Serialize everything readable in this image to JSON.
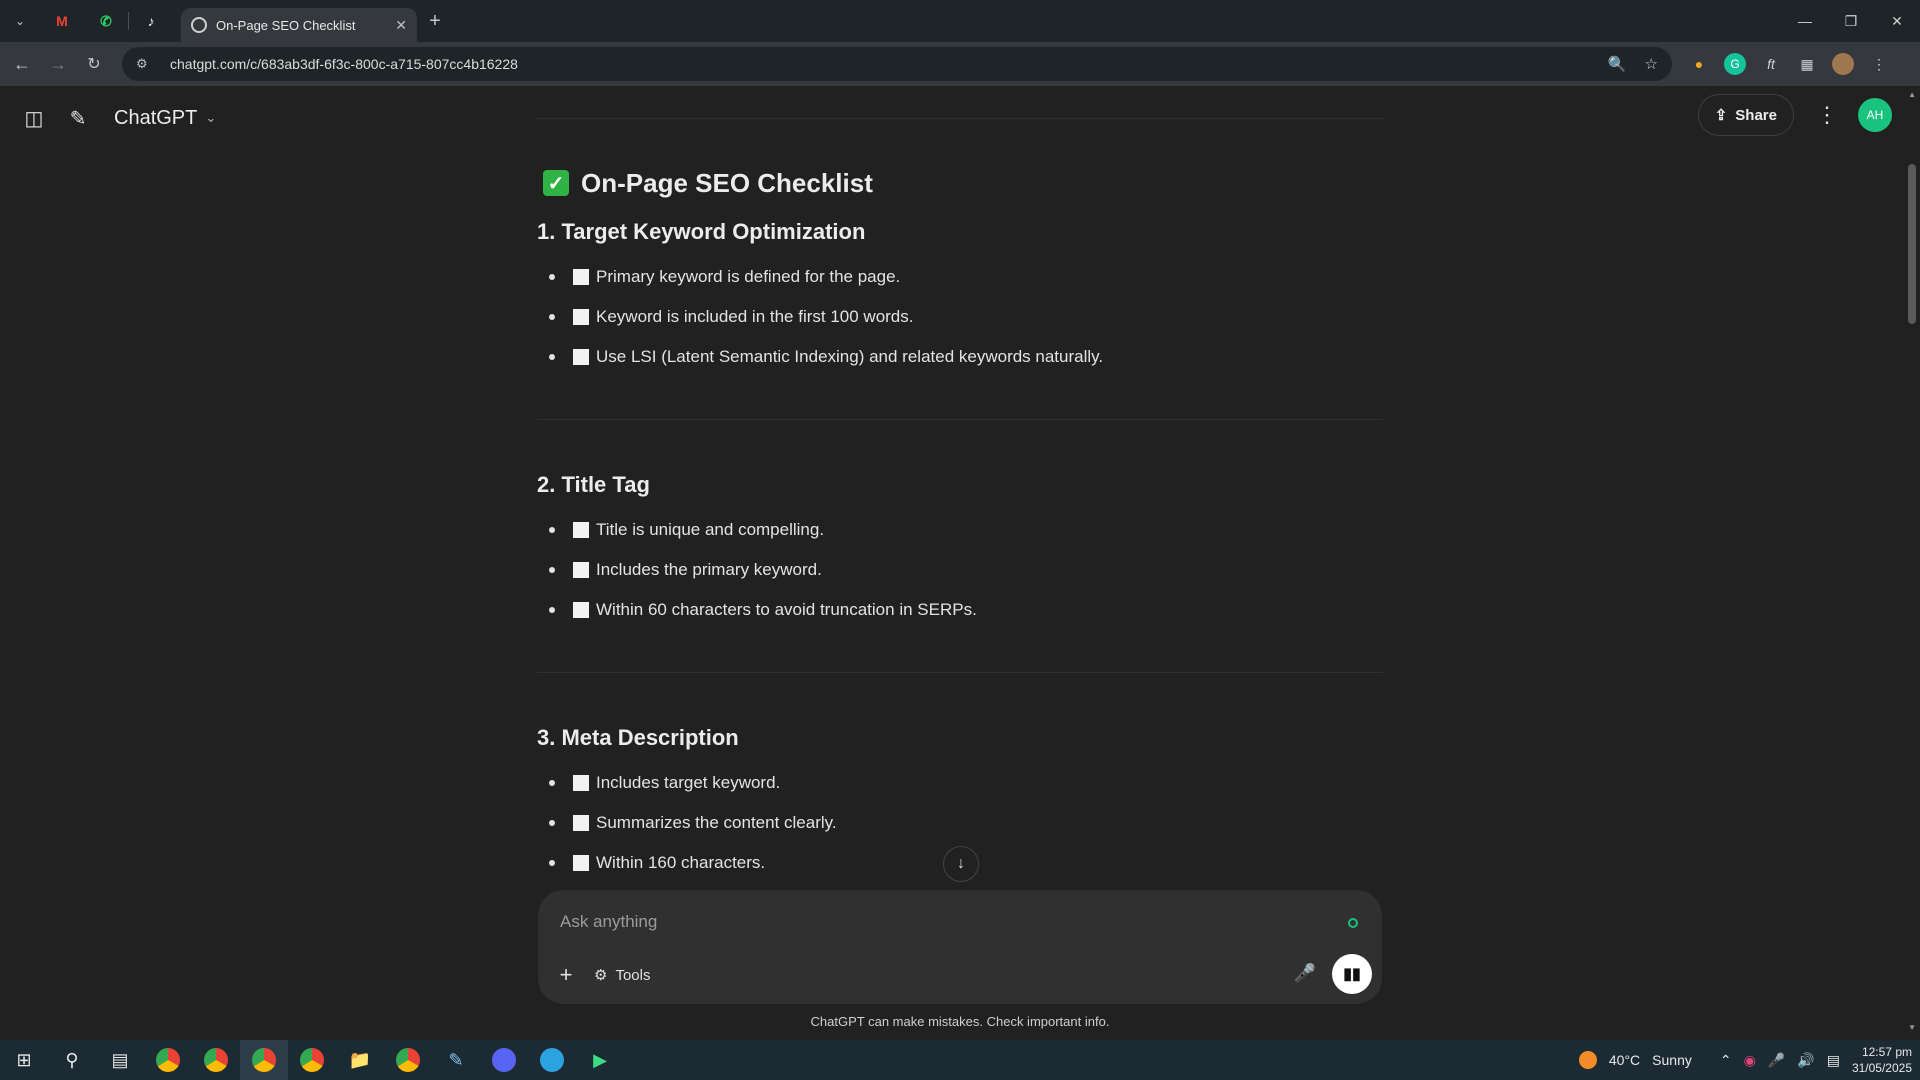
{
  "browser": {
    "tab_title": "On-Page SEO Checklist",
    "url": "chatgpt.com/c/683ab3df-6f3c-800c-a715-807cc4b16228",
    "pinned_tabs": [
      "gmail-icon",
      "whatsapp-icon",
      "tiktok-icon"
    ]
  },
  "header": {
    "brand": "ChatGPT",
    "share_label": "Share",
    "avatar_initials": "AH"
  },
  "doc": {
    "title": "On-Page SEO Checklist",
    "sections": [
      {
        "heading": "1. Target Keyword Optimization",
        "items": [
          "Primary keyword is defined for the page.",
          "Keyword is included in the first 100 words.",
          "Use LSI (Latent Semantic Indexing) and related keywords naturally."
        ]
      },
      {
        "heading": "2. Title Tag",
        "items": [
          "Title is unique and compelling.",
          "Includes the primary keyword.",
          "Within 60 characters to avoid truncation in SERPs."
        ]
      },
      {
        "heading": "3. Meta Description",
        "items": [
          "Includes target keyword.",
          "Summarizes the content clearly.",
          "Within 160 characters."
        ]
      }
    ]
  },
  "composer": {
    "placeholder": "Ask anything",
    "tools_label": "Tools",
    "disclaimer": "ChatGPT can make mistakes. Check important info."
  },
  "taskbar": {
    "temperature": "40°C",
    "weather": "Sunny",
    "time": "12:57 pm",
    "date": "31/05/2025"
  },
  "colors": {
    "accent_green": "#19c37d",
    "background": "#212121",
    "composer": "#303030"
  }
}
